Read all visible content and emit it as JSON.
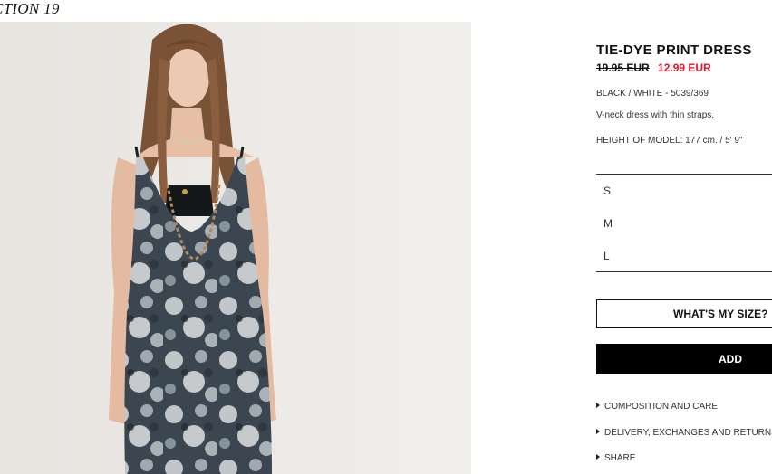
{
  "collection": {
    "label": "CTION 19"
  },
  "image": {
    "alt": "Model wearing tie-dye print slip dress"
  },
  "product": {
    "title": "TIE-DYE PRINT DRESS",
    "old_price": "19.95 EUR",
    "new_price": "12.99 EUR",
    "color_ref": "BLACK / WHITE - 5039/369",
    "description": "V-neck dress with thin straps.",
    "model_height": "HEIGHT OF MODEL: 177 cm. / 5' 9\""
  },
  "sizes": [
    "S",
    "M",
    "L"
  ],
  "buttons": {
    "size_guide": "WHAT'S MY SIZE?",
    "add": "ADD"
  },
  "links": [
    {
      "label": "COMPOSITION AND CARE",
      "icon": "triangle-right-icon"
    },
    {
      "label": "DELIVERY, EXCHANGES AND RETURNS",
      "icon": "triangle-right-icon"
    },
    {
      "label": "SHARE",
      "icon": "triangle-right-icon"
    }
  ],
  "colors": {
    "sale": "#e5172c",
    "primary": "#000000",
    "background": "#ffffff"
  }
}
